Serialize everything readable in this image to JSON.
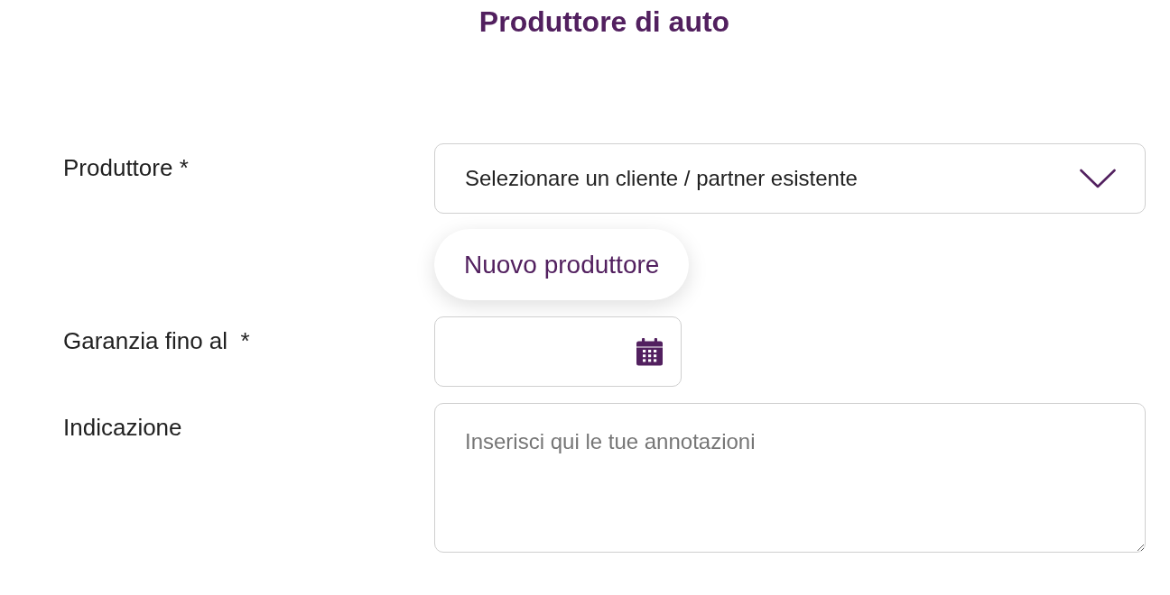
{
  "title": "Produttore di auto",
  "fields": [
    {
      "kind": "select",
      "label": "Produttore *",
      "value": "Selezionare un cliente / partner esistente",
      "action": "Nuovo produttore"
    },
    {
      "kind": "date",
      "label": "Garanzia fino al  *"
    },
    {
      "kind": "textarea",
      "label": "Indicazione",
      "placeholder": "Inserisci qui le tue annotazioni"
    }
  ]
}
